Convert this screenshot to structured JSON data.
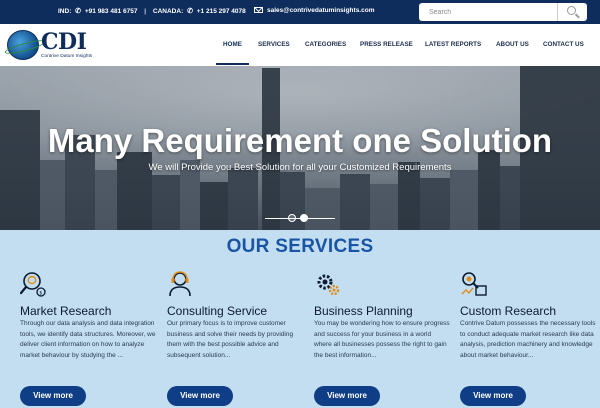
{
  "topbar": {
    "ind_label": "IND:",
    "ind_phone": "+91 983 481 6757",
    "separator": "|",
    "canada_label": "CANADA:",
    "canada_phone": "+1 215 297 4078",
    "email": "sales@contrivedatuminsights.com",
    "search_placeholder": "Search"
  },
  "logo": {
    "mark": "CDI",
    "tagline": "Contrive Datum Insights"
  },
  "nav": {
    "items": [
      {
        "label": "HOME"
      },
      {
        "label": "SERVICES"
      },
      {
        "label": "CATEGORIES"
      },
      {
        "label": "PRESS RELEASE"
      },
      {
        "label": "LATEST REPORTS"
      },
      {
        "label": "ABOUT US"
      },
      {
        "label": "CONTACT US"
      }
    ]
  },
  "hero": {
    "title": "Many Requirement one Solution",
    "subtitle": "We will Provide you Best Solution for all your Customized Requirements"
  },
  "services": {
    "heading": "OUR SERVICES",
    "cards": [
      {
        "icon": "magnifier-brain-icon",
        "title": "Market Research",
        "text": "Through our data analysis and data integration tools, we identify data structures. Moreover, we deliver client information on how to analyze market behaviour by studying the ...",
        "button": "View more"
      },
      {
        "icon": "consultant-headset-icon",
        "title": "Consulting Service",
        "text": "Our primary focus is to improve customer business and solve their needs by providing them with the best possible advice and subsequent solution...",
        "button": "View more"
      },
      {
        "icon": "gears-icon",
        "title": "Business Planning",
        "text": "You may be wondering how to ensure progress and success for your business in a world where all businesses possess the right to gain the best information...",
        "button": "View more"
      },
      {
        "icon": "research-tools-icon",
        "title": "Custom Research",
        "text": "Contrive Datum possesses the necessary tools to conduct adequate market research like data analysis, prediction machinery and knowledge about market behaviour...",
        "button": "View more"
      }
    ]
  },
  "colors": {
    "topbar_bg": "#0f2d5c",
    "services_bg": "#c3def0",
    "heading_blue": "#1a55a5",
    "button_blue": "#0f3e86"
  }
}
